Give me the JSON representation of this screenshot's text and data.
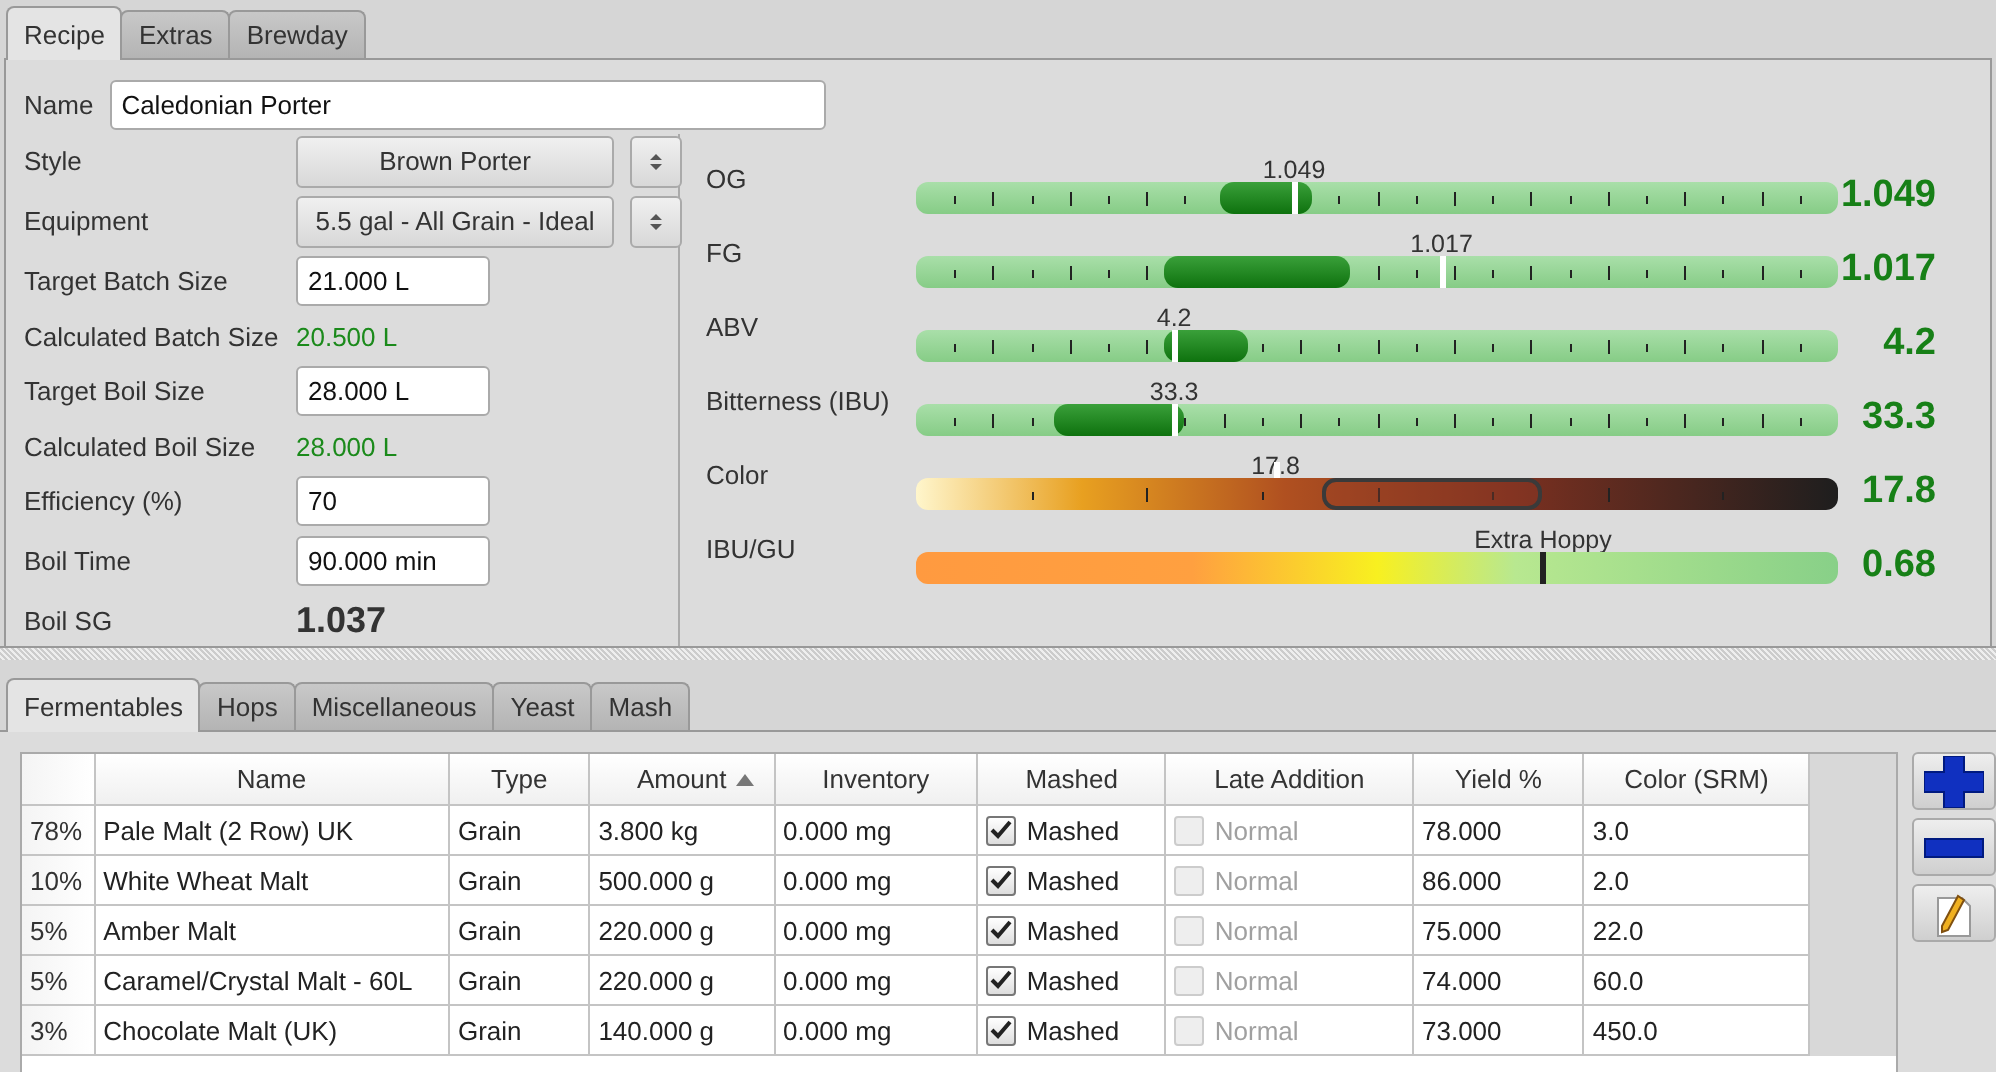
{
  "recipe_tabs": [
    {
      "label": "Recipe",
      "selected": true
    },
    {
      "label": "Extras",
      "selected": false
    },
    {
      "label": "Brewday",
      "selected": false
    }
  ],
  "form": {
    "name_label": "Name",
    "name_value": "Caledonian Porter",
    "fields": [
      {
        "kind": "select",
        "label": "Style",
        "value": "Brown Porter"
      },
      {
        "kind": "select",
        "label": "Equipment",
        "value": "5.5 gal - All Grain - Ideal"
      },
      {
        "kind": "input",
        "label": "Target Batch Size",
        "value": "21.000 L"
      },
      {
        "kind": "calc",
        "label": "Calculated Batch Size",
        "value": "20.500 L"
      },
      {
        "kind": "input",
        "label": "Target Boil Size",
        "value": "28.000 L"
      },
      {
        "kind": "calc",
        "label": "Calculated Boil Size",
        "value": "28.000 L"
      },
      {
        "kind": "input",
        "label": "Efficiency (%)",
        "value": "70"
      },
      {
        "kind": "input",
        "label": "Boil Time",
        "value": "90.000 min"
      },
      {
        "kind": "big",
        "label": "Boil SG",
        "value": "1.037"
      }
    ]
  },
  "meters": [
    {
      "kind": "gauge",
      "label": "OG",
      "marker_label": "1.049",
      "value": "1.049",
      "level": 0.41,
      "band_from": {
        "level": 0.33
      },
      "band_to": {
        "level": 0.43
      }
    },
    {
      "kind": "gauge",
      "label": "FG",
      "marker_label": "1.017",
      "value": "1.017",
      "level": 0.57,
      "band_from": {
        "level": 0.27
      },
      "band_to": {
        "level": 0.47
      }
    },
    {
      "kind": "gauge",
      "label": "ABV",
      "marker_label": "4.2",
      "value": "4.2",
      "level": 0.28,
      "band_from": {
        "level": 0.27
      },
      "band_to": {
        "level": 0.36
      }
    },
    {
      "kind": "gauge",
      "label": "Bitterness (IBU)",
      "marker_label": "33.3",
      "value": "33.3",
      "level": 0.28,
      "band_from": {
        "level": 0.15
      },
      "band_to": {
        "level": 0.29
      }
    },
    {
      "kind": "color",
      "label": "Color",
      "marker_label": "17.8",
      "value": "17.8",
      "level": 0.39,
      "band_from": {
        "level": 0.44
      },
      "band_to": {
        "level": 0.68
      }
    },
    {
      "kind": "ratio",
      "label": "IBU/GU",
      "marker_label": "Extra Hoppy",
      "value": "0.68",
      "level": 0.68
    }
  ],
  "ingredient_tabs": [
    {
      "label": "Fermentables",
      "selected": true
    },
    {
      "label": "Hops",
      "selected": false
    },
    {
      "label": "Miscellaneous",
      "selected": false
    },
    {
      "label": "Yeast",
      "selected": false
    },
    {
      "label": "Mash",
      "selected": false
    }
  ],
  "table": {
    "columns": [
      {
        "label": "Name",
        "sorted": false
      },
      {
        "label": "Type",
        "sorted": false
      },
      {
        "label": "Amount",
        "sorted": true
      },
      {
        "label": "Inventory",
        "sorted": false
      },
      {
        "label": "Mashed",
        "sorted": false
      },
      {
        "label": "Late Addition",
        "sorted": false
      },
      {
        "label": "Yield %",
        "sorted": false
      },
      {
        "label": "Color (SRM)",
        "sorted": false
      }
    ],
    "rows": [
      {
        "percent": "78%",
        "name": "Pale Malt (2 Row) UK",
        "type": "Grain",
        "amount": "3.800 kg",
        "inventory": "0.000 mg",
        "mashed": {
          "checked": true,
          "disabled": false,
          "label": "Mashed"
        },
        "late_addition": {
          "checked": false,
          "disabled": true,
          "label": "Normal"
        },
        "yield": "78.000",
        "color_srm": "3.0"
      },
      {
        "percent": "10%",
        "name": "White Wheat Malt",
        "type": "Grain",
        "amount": "500.000 g",
        "inventory": "0.000 mg",
        "mashed": {
          "checked": true,
          "disabled": false,
          "label": "Mashed"
        },
        "late_addition": {
          "checked": false,
          "disabled": true,
          "label": "Normal"
        },
        "yield": "86.000",
        "color_srm": "2.0"
      },
      {
        "percent": "5%",
        "name": "Amber Malt",
        "type": "Grain",
        "amount": "220.000 g",
        "inventory": "0.000 mg",
        "mashed": {
          "checked": true,
          "disabled": false,
          "label": "Mashed"
        },
        "late_addition": {
          "checked": false,
          "disabled": true,
          "label": "Normal"
        },
        "yield": "75.000",
        "color_srm": "22.0"
      },
      {
        "percent": "5%",
        "name": "Caramel/Crystal Malt - 60L",
        "type": "Grain",
        "amount": "220.000 g",
        "inventory": "0.000 mg",
        "mashed": {
          "checked": true,
          "disabled": false,
          "label": "Mashed"
        },
        "late_addition": {
          "checked": false,
          "disabled": true,
          "label": "Normal"
        },
        "yield": "74.000",
        "color_srm": "60.0"
      },
      {
        "percent": "3%",
        "name": "Chocolate Malt (UK)",
        "type": "Grain",
        "amount": "140.000 g",
        "inventory": "0.000 mg",
        "mashed": {
          "checked": true,
          "disabled": false,
          "label": "Mashed"
        },
        "late_addition": {
          "checked": false,
          "disabled": true,
          "label": "Normal"
        },
        "yield": "73.000",
        "color_srm": "450.0"
      }
    ]
  }
}
